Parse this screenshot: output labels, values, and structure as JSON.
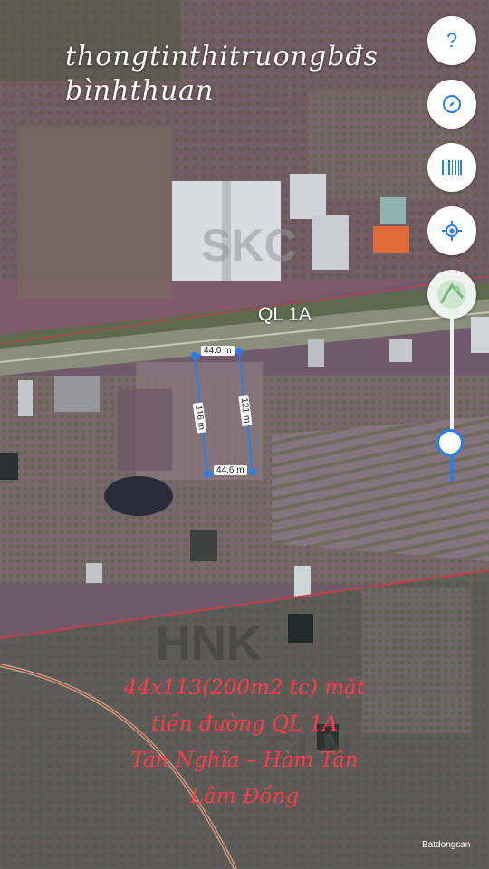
{
  "title_lines": [
    "thongtinthitruongbđs",
    "bìnhthuan"
  ],
  "road_label": "QL 1A",
  "zones": [
    "SKC",
    "HNK",
    "CLN"
  ],
  "dimensions": {
    "top": "44.0 m",
    "bottom": "44.6 m",
    "left": "116 m",
    "right": "121 m"
  },
  "caption_lines": [
    "44x113(200m2 tc) mặt",
    "tiền đường QL 1A",
    "Tân Nghĩa – Hàm Tân",
    "Lâm Đồng"
  ],
  "controls": {
    "help_icon": "question-icon",
    "compass_icon": "compass-icon",
    "barcode_icon": "barcode-icon",
    "locate_icon": "locate-icon",
    "layer_icon": "map-layer-icon"
  },
  "slider_level": 0.23,
  "watermark": "Batdongsan",
  "colors": {
    "plot_outline": "#2b7de9",
    "caption": "#ff3b4a",
    "zone_border": "#c0404a"
  }
}
